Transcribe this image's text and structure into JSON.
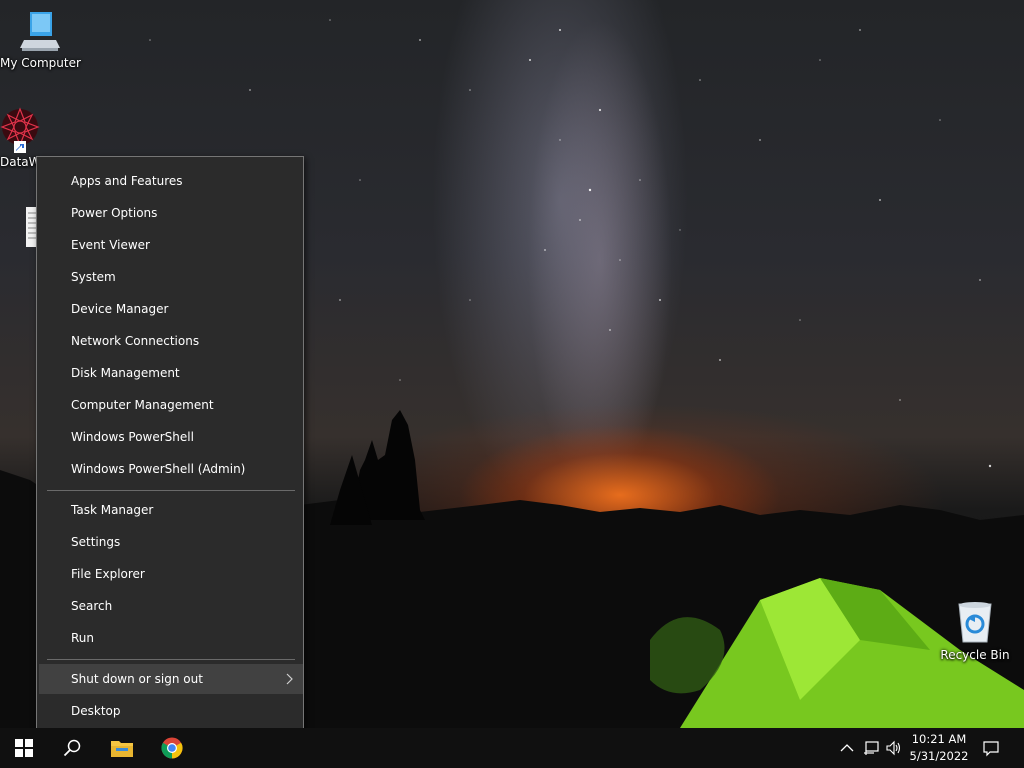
{
  "desktop": {
    "icons": {
      "my_computer": "My Computer",
      "datawiz": "DataW",
      "recycle_bin": "Recycle Bin"
    }
  },
  "context_menu": {
    "items": [
      "Apps and Features",
      "Power Options",
      "Event Viewer",
      "System",
      "Device Manager",
      "Network Connections",
      "Disk Management",
      "Computer Management",
      "Windows PowerShell",
      "Windows PowerShell (Admin)",
      "Task Manager",
      "Settings",
      "File Explorer",
      "Search",
      "Run",
      "Shut down or sign out",
      "Desktop"
    ],
    "highlighted": "Shut down or sign out"
  },
  "taskbar": {
    "pinned": [
      "start-button",
      "search-button",
      "file-explorer",
      "chrome"
    ],
    "clock": {
      "time": "10:21 AM",
      "date": "5/31/2022"
    },
    "tray_icons": [
      "chevron-up-icon",
      "network-icon",
      "volume-icon",
      "notification-icon"
    ]
  },
  "colors": {
    "menu_background": "#2b2b2b",
    "menu_hover": "#414141",
    "taskbar": "#101010",
    "tent": "#7ed321"
  }
}
